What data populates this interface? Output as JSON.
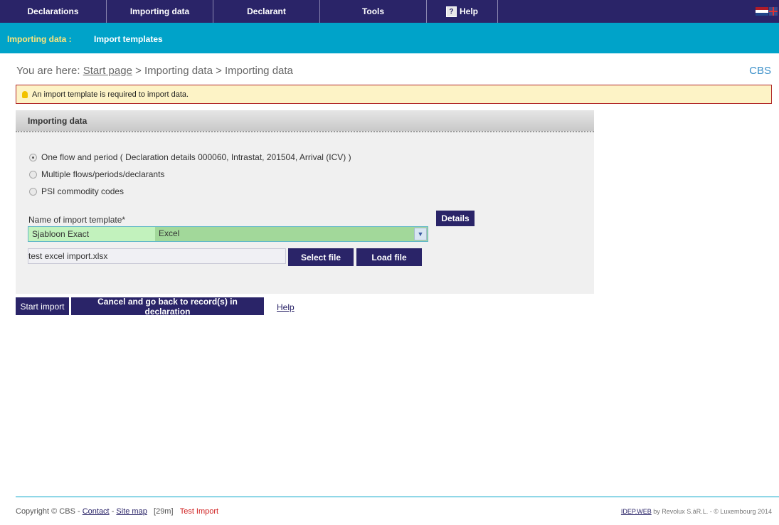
{
  "topnav": {
    "items": [
      {
        "label": "Declarations"
      },
      {
        "label": "Importing data"
      },
      {
        "label": "Declarant"
      },
      {
        "label": "Tools"
      },
      {
        "label": "Help"
      }
    ],
    "flag_colors": {
      "red": "#ae1c28",
      "white": "#ffffff",
      "blue": "#21468b"
    }
  },
  "subbar": {
    "section": "Importing data :",
    "item": "Import templates"
  },
  "breadcrumb": {
    "prefix": "You are here:",
    "home": "Start page",
    "rest": " > Importing data > Importing data"
  },
  "org_link": "CBS",
  "alert": {
    "message": "An import template is required to import data."
  },
  "panel": {
    "title": "Importing data",
    "options": [
      {
        "label": "One flow and period ( Declaration details 000060, Intrastat, 201504, Arrival (ICV) )",
        "checked": true
      },
      {
        "label": "Multiple flows/periods/declarants",
        "checked": false
      },
      {
        "label": "PSI commodity codes",
        "checked": false
      }
    ],
    "template_label": "Name of import template*",
    "template_name": "Sjabloon Exact",
    "template_type": "Excel",
    "details_button": "Details",
    "file_value": "test excel import.xlsx",
    "select_file_button": "Select file",
    "load_file_button": "Load file"
  },
  "actions": {
    "start_import": "Start import",
    "cancel": "Cancel and go back to record(s) in declaration",
    "help": "Help"
  },
  "footer": {
    "copyright": "Copyright © CBS -",
    "contact": "Contact",
    "sep": "-",
    "sitemap": "Site map",
    "timer": "[29m]",
    "mode": "Test Import",
    "product": "IDEP.WEB",
    "vendor": "by Revolux S.àR.L. - © Luxembourg 2014"
  }
}
